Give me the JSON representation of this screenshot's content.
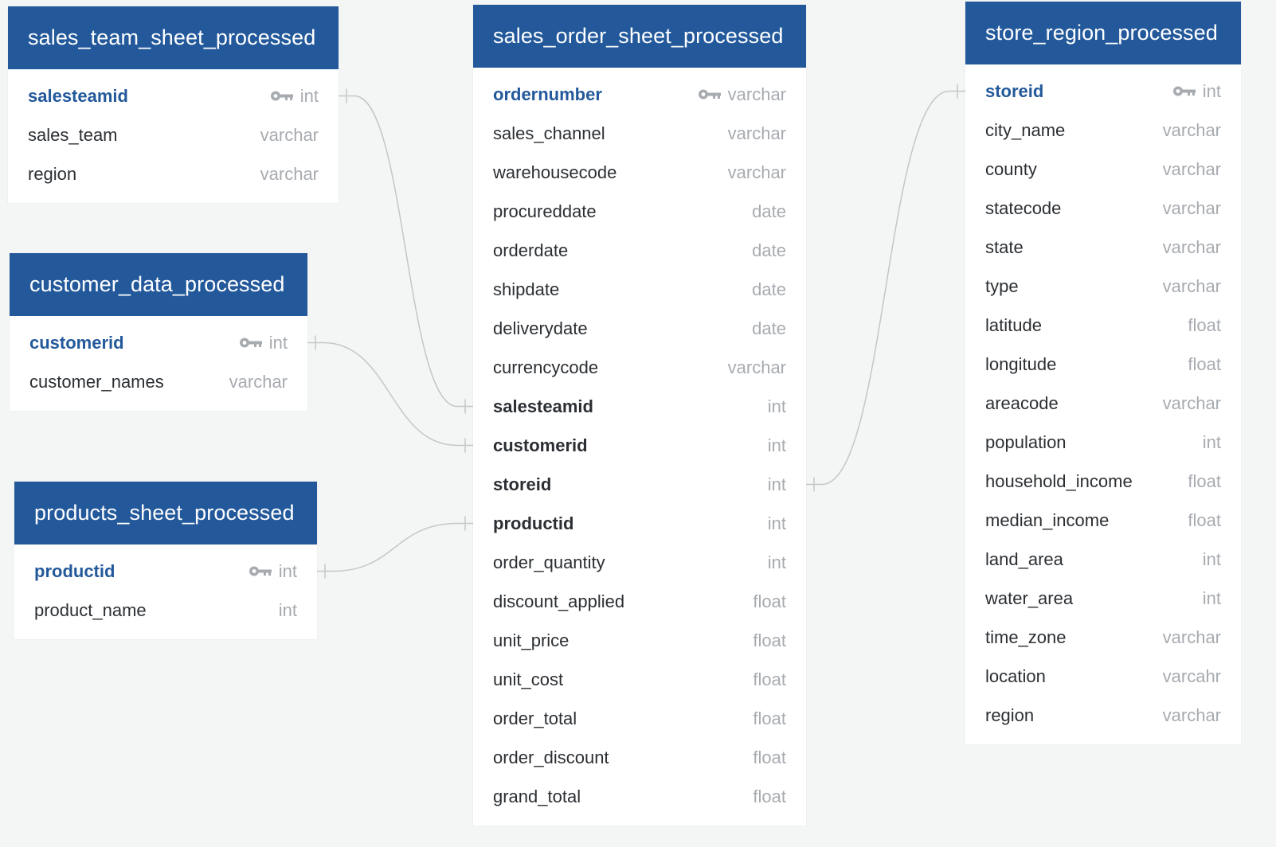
{
  "colors": {
    "background": "#f4f5f5",
    "header": "#23599b",
    "header_text": "#ffffff",
    "pk_text": "#23599b",
    "type_text": "#a7abb0",
    "connector": "#c4c6c8"
  },
  "tables": {
    "sales_team": {
      "title": "sales_team_sheet_processed",
      "columns": [
        {
          "name": "salesteamid",
          "type": "int",
          "pk": true
        },
        {
          "name": "sales_team",
          "type": "varchar"
        },
        {
          "name": "region",
          "type": "varchar"
        }
      ]
    },
    "customer": {
      "title": "customer_data_processed",
      "columns": [
        {
          "name": "customerid",
          "type": "int",
          "pk": true
        },
        {
          "name": "customer_names",
          "type": "varchar"
        }
      ]
    },
    "products": {
      "title": "products_sheet_processed",
      "columns": [
        {
          "name": "productid",
          "type": "int",
          "pk": true
        },
        {
          "name": "product_name",
          "type": "int"
        }
      ]
    },
    "sales_order": {
      "title": "sales_order_sheet_processed",
      "columns": [
        {
          "name": "ordernumber",
          "type": "varchar",
          "pk": true
        },
        {
          "name": "sales_channel",
          "type": "varchar"
        },
        {
          "name": "warehousecode",
          "type": "varchar"
        },
        {
          "name": "procureddate",
          "type": "date"
        },
        {
          "name": "orderdate",
          "type": "date"
        },
        {
          "name": "shipdate",
          "type": "date"
        },
        {
          "name": "deliverydate",
          "type": "date"
        },
        {
          "name": "currencycode",
          "type": "varchar"
        },
        {
          "name": "salesteamid",
          "type": "int",
          "fk": true
        },
        {
          "name": "customerid",
          "type": "int",
          "fk": true
        },
        {
          "name": "storeid",
          "type": "int",
          "fk": true
        },
        {
          "name": "productid",
          "type": "int",
          "fk": true
        },
        {
          "name": "order_quantity",
          "type": "int"
        },
        {
          "name": "discount_applied",
          "type": "float"
        },
        {
          "name": "unit_price",
          "type": "float"
        },
        {
          "name": "unit_cost",
          "type": "float"
        },
        {
          "name": "order_total",
          "type": "float"
        },
        {
          "name": "order_discount",
          "type": "float"
        },
        {
          "name": "grand_total",
          "type": "float"
        }
      ]
    },
    "store_region": {
      "title": "store_region_processed",
      "columns": [
        {
          "name": "storeid",
          "type": "int",
          "pk": true
        },
        {
          "name": "city_name",
          "type": "varchar"
        },
        {
          "name": "county",
          "type": "varchar"
        },
        {
          "name": "statecode",
          "type": "varchar"
        },
        {
          "name": "state",
          "type": "varchar"
        },
        {
          "name": "type",
          "type": "varchar"
        },
        {
          "name": "latitude",
          "type": "float"
        },
        {
          "name": "longitude",
          "type": "float"
        },
        {
          "name": "areacode",
          "type": "varchar"
        },
        {
          "name": "population",
          "type": "int"
        },
        {
          "name": "household_income",
          "type": "float"
        },
        {
          "name": "median_income",
          "type": "float"
        },
        {
          "name": "land_area",
          "type": "int"
        },
        {
          "name": "water_area",
          "type": "int"
        },
        {
          "name": "time_zone",
          "type": "varchar"
        },
        {
          "name": "location",
          "type": "varcahr"
        },
        {
          "name": "region",
          "type": "varchar"
        }
      ]
    }
  },
  "relationships": [
    {
      "from_table": "sales_team",
      "from_column": "salesteamid",
      "to_table": "sales_order",
      "to_column": "salesteamid"
    },
    {
      "from_table": "customer",
      "from_column": "customerid",
      "to_table": "sales_order",
      "to_column": "customerid"
    },
    {
      "from_table": "products",
      "from_column": "productid",
      "to_table": "sales_order",
      "to_column": "productid"
    },
    {
      "from_table": "store_region",
      "from_column": "storeid",
      "to_table": "sales_order",
      "to_column": "storeid"
    }
  ]
}
